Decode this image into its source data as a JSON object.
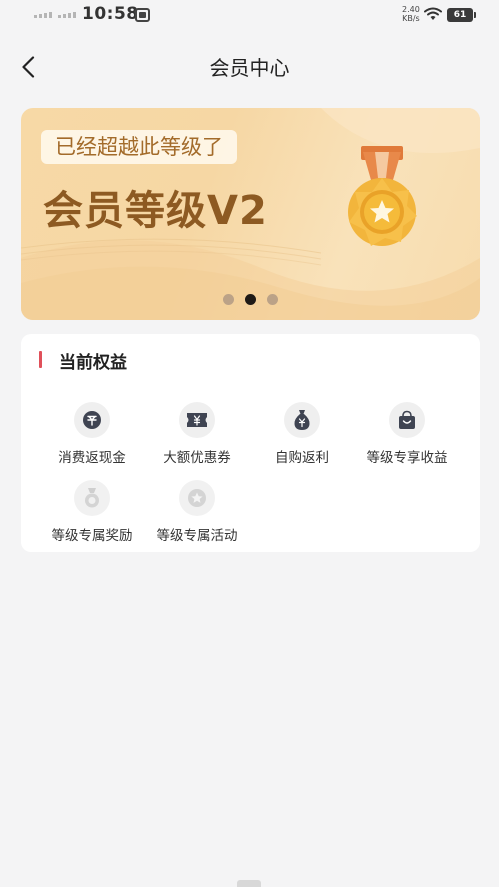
{
  "status_bar": {
    "time": "10:58",
    "network_speed_value": "2.40",
    "network_speed_unit": "KB/s",
    "battery": "61"
  },
  "nav": {
    "title": "会员中心"
  },
  "banner": {
    "subtitle": "已经超越此等级了",
    "title": "会员等级V2",
    "slide_count": 3,
    "active_slide": 1
  },
  "benefits": {
    "title": "当前权益",
    "items": [
      {
        "label": "消费返现金",
        "icon": "cashback-icon"
      },
      {
        "label": "大额优惠券",
        "icon": "coupon-icon"
      },
      {
        "label": "自购返利",
        "icon": "money-bag-icon"
      },
      {
        "label": "等级专享收益",
        "icon": "shopping-bag-icon"
      },
      {
        "label": "等级专属奖励",
        "icon": "medal-icon"
      },
      {
        "label": "等级专属活动",
        "icon": "star-icon"
      }
    ]
  }
}
